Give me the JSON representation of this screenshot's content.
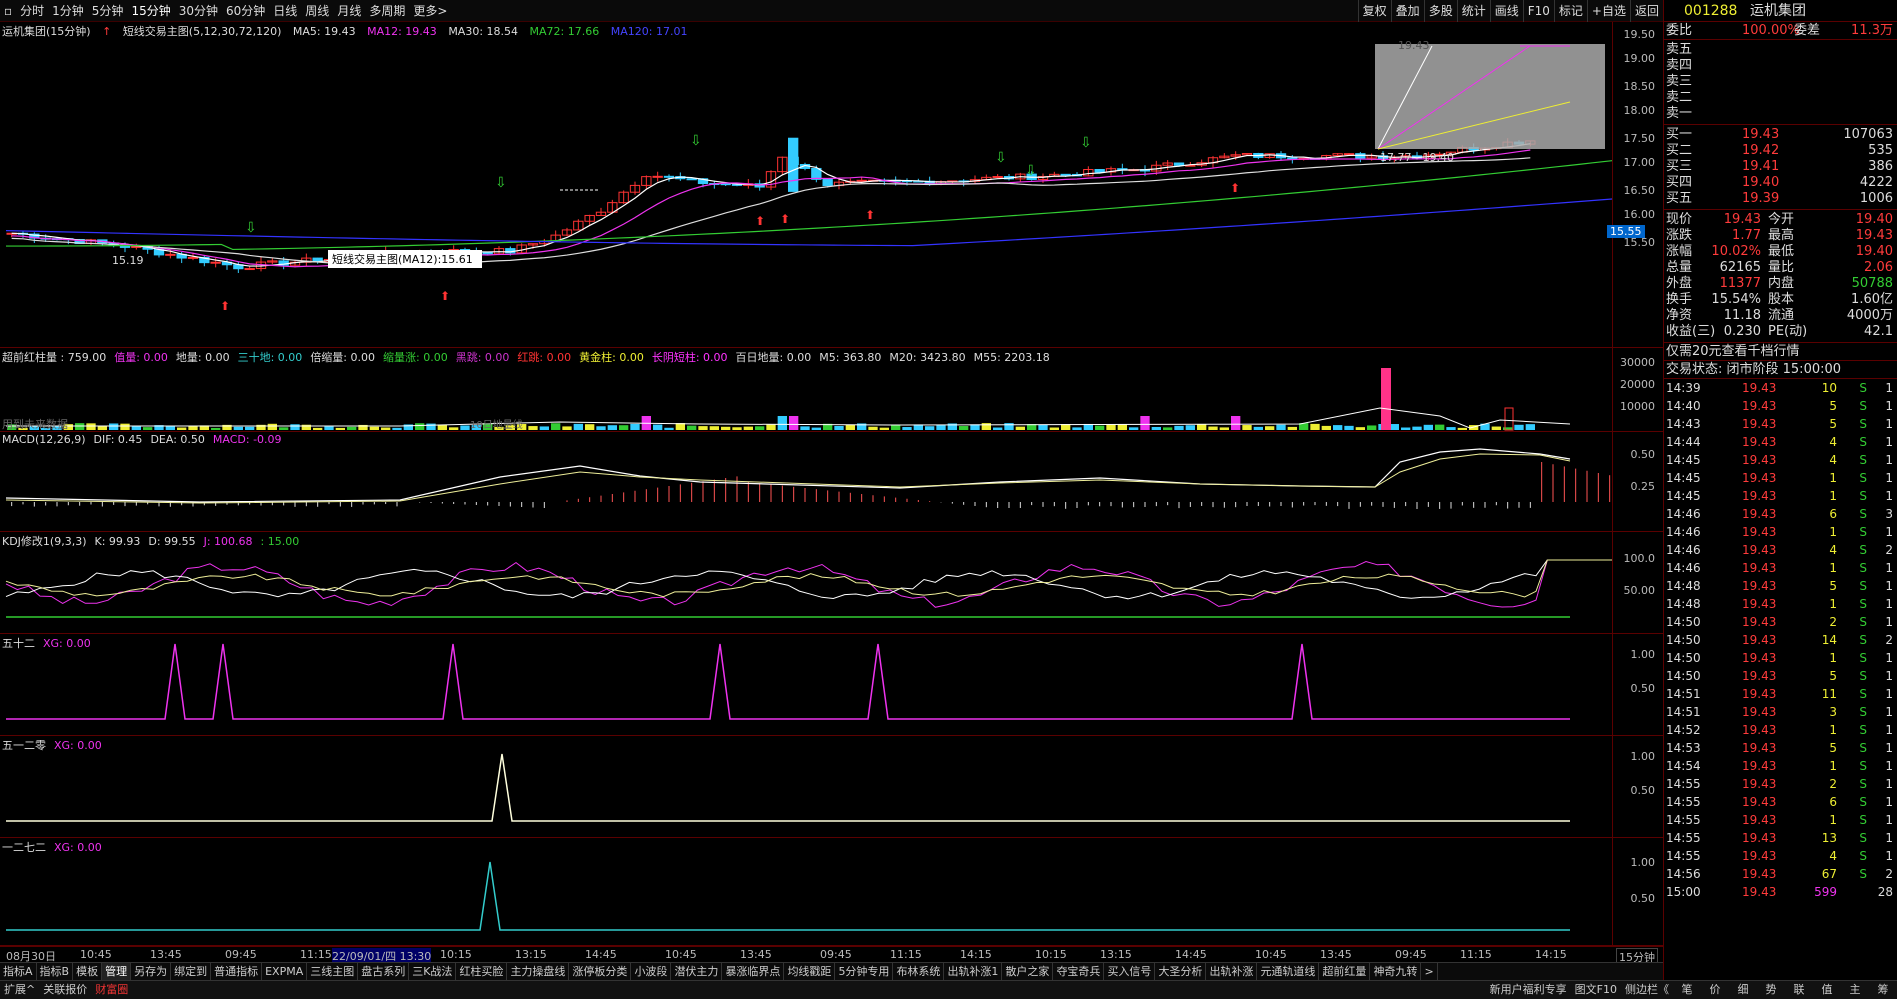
{
  "toolbar": {
    "items": [
      "分时",
      "1分钟",
      "5分钟",
      "15分钟",
      "30分钟",
      "60分钟",
      "日线",
      "周线",
      "月线",
      "多周期",
      "更多>"
    ],
    "right": [
      "复权",
      "叠加",
      "多股",
      "统计",
      "画线",
      "F10",
      "标记",
      "+自选",
      "返回"
    ]
  },
  "main": {
    "title": "运机集团(15分钟)",
    "indicator": "短线交易主图(5,12,30,72,120)",
    "ma5": "MA5: 19.43",
    "ma12": "MA12: 19.43",
    "ma30": "MA30: 18.54",
    "ma72": "MA72: 17.66",
    "ma120": "MA120: 17.01",
    "yticks": [
      "19.50",
      "19.00",
      "18.50",
      "18.00",
      "17.50",
      "17.00",
      "16.50",
      "16.00",
      "15.50"
    ],
    "current_price_tag": "15.55",
    "tooltip": "短线交易主图(MA12):15.61",
    "low_label": "15.19",
    "range_label": "17.77 - 19.40",
    "high_label": "19.43"
  },
  "vol": {
    "hdr": [
      "超前红柱量 : 759.00",
      "值量: 0.00",
      "地量: 0.00",
      "三十地: 0.00",
      "倍缩量: 0.00",
      "缩量涨: 0.00",
      "黑跳: 0.00",
      "红跳: 0.00",
      "黄金柱: 0.00",
      "长阴短柱: 0.00",
      "百日地量: 0.00",
      "M5: 363.80",
      "M20: 3423.80",
      "M55: 2203.18"
    ],
    "yticks": [
      "30000",
      "20000",
      "10000"
    ],
    "left_note": "用到未来数据",
    "mid_note": "10日地量线"
  },
  "macd": {
    "hdr": [
      "MACD(12,26,9)",
      "DIF: 0.45",
      "DEA: 0.50",
      "MACD: -0.09"
    ],
    "yticks": [
      "0.50",
      "0.25"
    ]
  },
  "kdj": {
    "hdr": [
      "KDJ修改1(9,3,3)",
      "K: 99.93",
      "D: 99.55",
      "J: 100.68",
      ": 15.00"
    ],
    "yticks": [
      "100.0",
      "50.00"
    ]
  },
  "p52": {
    "hdr": [
      "五十二",
      "XG: 0.00"
    ],
    "yticks": [
      "1.00",
      "0.50"
    ]
  },
  "p512": {
    "hdr": [
      "五一二零",
      "XG: 0.00"
    ],
    "yticks": [
      "1.00",
      "0.50"
    ]
  },
  "p127": {
    "hdr": [
      "一二七二",
      "XG: 0.00"
    ],
    "yticks": [
      "1.00",
      "0.50"
    ]
  },
  "xaxis": [
    "08月30日",
    "10:45",
    "13:45",
    "09:45",
    "11:15",
    "22/09/01/四 13:30",
    "10:15",
    "13:15",
    "14:45",
    "10:45",
    "13:45",
    "09:45",
    "11:15",
    "14:15",
    "10:15",
    "13:15",
    "14:45",
    "10:45",
    "13:45",
    "09:45",
    "11:15",
    "14:15"
  ],
  "period_label": "15分钟",
  "tabs": [
    "指标A",
    "指标B",
    "模板",
    "管理",
    "另存为",
    "绑定到",
    "普通指标",
    "EXPMA",
    "三线主图",
    "盘古系列",
    "三K战法",
    "红柱买脸",
    "主力操盘线",
    "涨停板分类",
    "小波段",
    "潜伏主力",
    "暴涨临界点",
    "均线戳距",
    "5分钟专用",
    "布林系统",
    "出轨补涨1",
    "散户之家",
    "夺宝奇兵",
    "买入信号",
    "大圣分析",
    "出轨补涨",
    "元通轨道线",
    "超前红量",
    "神奇九转"
  ],
  "status": {
    "left": [
      "扩展^",
      "关联报价",
      "财富圈"
    ],
    "right": [
      "新用户福利专享",
      "图文F10",
      "侧边栏《",
      "笔",
      "价",
      "细",
      "势",
      "联",
      "值",
      "主",
      "筹"
    ]
  },
  "side": {
    "code": "001288",
    "name": "运机集团",
    "weibi_label": "委比",
    "weibi": "100.00%",
    "weicha_label": "委差",
    "weicha": "11.3万",
    "sells": [
      "卖五",
      "卖四",
      "卖三",
      "卖二",
      "卖一"
    ],
    "buys": [
      {
        "l": "买一",
        "p": "19.43",
        "v": "107063"
      },
      {
        "l": "买二",
        "p": "19.42",
        "v": "535"
      },
      {
        "l": "买三",
        "p": "19.41",
        "v": "386"
      },
      {
        "l": "买四",
        "p": "19.40",
        "v": "4222"
      },
      {
        "l": "买五",
        "p": "19.39",
        "v": "1006"
      }
    ],
    "stats": [
      [
        "现价",
        "19.43",
        "今开",
        "19.40"
      ],
      [
        "涨跌",
        "1.77",
        "最高",
        "19.43"
      ],
      [
        "涨幅",
        "10.02%",
        "最低",
        "19.40"
      ],
      [
        "总量",
        "62165",
        "量比",
        "2.06"
      ],
      [
        "外盘",
        "11377",
        "内盘",
        "50788"
      ],
      [
        "换手",
        "15.54%",
        "股本",
        "1.60亿"
      ],
      [
        "净资",
        "11.18",
        "流通",
        "4000万"
      ],
      [
        "收益(三)",
        "0.230",
        "PE(动)",
        "42.1"
      ]
    ],
    "promo": "仅需20元查看千档行情",
    "trade_state": "交易状态: 闭市阶段 15:00:00",
    "ticks": [
      [
        "14:39",
        "19.43",
        "10",
        "S",
        "1"
      ],
      [
        "14:40",
        "19.43",
        "5",
        "S",
        "1"
      ],
      [
        "14:43",
        "19.43",
        "5",
        "S",
        "1"
      ],
      [
        "14:44",
        "19.43",
        "4",
        "S",
        "1"
      ],
      [
        "14:45",
        "19.43",
        "4",
        "S",
        "1"
      ],
      [
        "14:45",
        "19.43",
        "1",
        "S",
        "1"
      ],
      [
        "14:45",
        "19.43",
        "1",
        "S",
        "1"
      ],
      [
        "14:46",
        "19.43",
        "6",
        "S",
        "3"
      ],
      [
        "14:46",
        "19.43",
        "1",
        "S",
        "1"
      ],
      [
        "14:46",
        "19.43",
        "4",
        "S",
        "2"
      ],
      [
        "14:46",
        "19.43",
        "1",
        "S",
        "1"
      ],
      [
        "14:48",
        "19.43",
        "5",
        "S",
        "1"
      ],
      [
        "14:48",
        "19.43",
        "1",
        "S",
        "1"
      ],
      [
        "14:50",
        "19.43",
        "2",
        "S",
        "1"
      ],
      [
        "14:50",
        "19.43",
        "14",
        "S",
        "2"
      ],
      [
        "14:50",
        "19.43",
        "1",
        "S",
        "1"
      ],
      [
        "14:50",
        "19.43",
        "5",
        "S",
        "1"
      ],
      [
        "14:51",
        "19.43",
        "11",
        "S",
        "1"
      ],
      [
        "14:51",
        "19.43",
        "3",
        "S",
        "1"
      ],
      [
        "14:52",
        "19.43",
        "1",
        "S",
        "1"
      ],
      [
        "14:53",
        "19.43",
        "5",
        "S",
        "1"
      ],
      [
        "14:54",
        "19.43",
        "1",
        "S",
        "1"
      ],
      [
        "14:55",
        "19.43",
        "2",
        "S",
        "1"
      ],
      [
        "14:55",
        "19.43",
        "6",
        "S",
        "1"
      ],
      [
        "14:55",
        "19.43",
        "1",
        "S",
        "1"
      ],
      [
        "14:55",
        "19.43",
        "13",
        "S",
        "1"
      ],
      [
        "14:55",
        "19.43",
        "4",
        "S",
        "1"
      ],
      [
        "14:56",
        "19.43",
        "67",
        "S",
        "2"
      ],
      [
        "15:00",
        "19.43",
        "599",
        "",
        "28"
      ]
    ]
  }
}
